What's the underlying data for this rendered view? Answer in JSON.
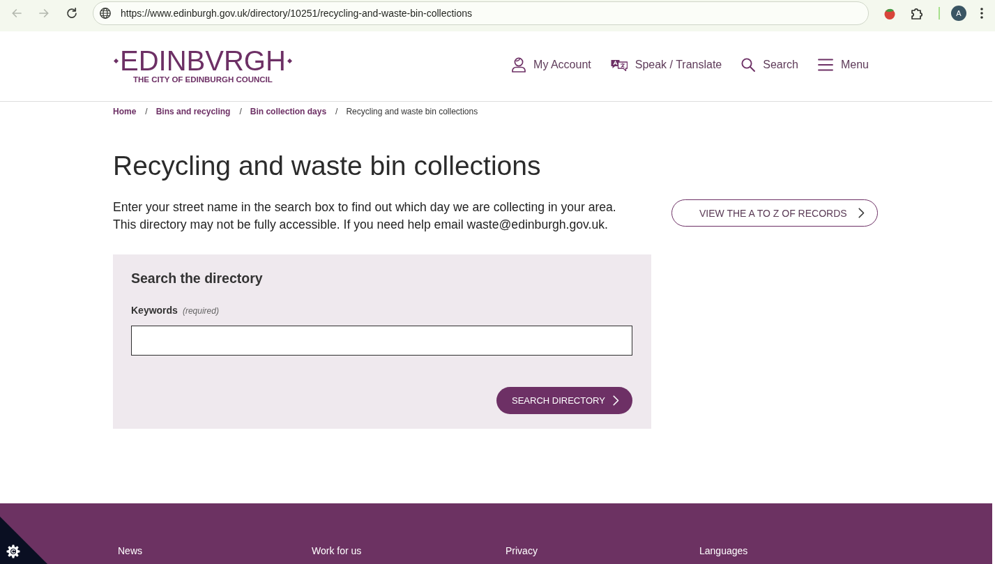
{
  "browser": {
    "nav_buttons": [
      {
        "kind": "back",
        "disabled": true
      },
      {
        "kind": "forward",
        "disabled": true
      },
      {
        "kind": "reload",
        "disabled": false
      }
    ],
    "url": "https://www.edinburgh.gov.uk/directory/10251/recycling-and-waste-bin-collections",
    "profile_initial": "A"
  },
  "header": {
    "logo": {
      "wordmark": "EDINBVRGH",
      "tagline": "THE CITY OF EDINBURGH COUNCIL"
    },
    "nav": [
      {
        "kind": "account",
        "label": "My Account"
      },
      {
        "kind": "translate",
        "label": "Speak / Translate"
      },
      {
        "kind": "search",
        "label": "Search"
      },
      {
        "kind": "menu",
        "label": "Menu"
      }
    ]
  },
  "breadcrumb": [
    {
      "label": "Home",
      "current": false
    },
    {
      "separator": "/",
      "label": "Bins and recycling",
      "current": false
    },
    {
      "separator": "/",
      "label": "Bin collection days",
      "current": false
    },
    {
      "separator": "/",
      "label": "Recycling and waste bin collections",
      "current": true
    }
  ],
  "page": {
    "title": "Recycling and waste bin collections",
    "intro": [
      "Enter your street name in the search box to find out which day we are collecting in your area.",
      "This directory may not be fully accessible. If you need help email waste@edinburgh.gov.uk."
    ],
    "a_to_z_button": "VIEW THE A TO Z OF RECORDS"
  },
  "search_panel": {
    "title": "Search the directory",
    "field": {
      "label": "Keywords",
      "requirement_note": "(required)"
    },
    "submit_button": "SEARCH DIRECTORY"
  },
  "footer": {
    "links": [
      "News",
      "Work for us",
      "Privacy",
      "Languages"
    ]
  }
}
